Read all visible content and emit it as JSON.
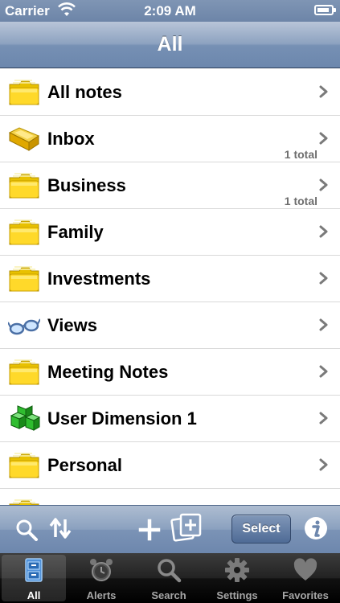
{
  "status_bar": {
    "carrier": "Carrier",
    "time": "2:09 AM"
  },
  "nav": {
    "title": "All"
  },
  "list": {
    "items": [
      {
        "label": "All notes",
        "icon": "folder-icon",
        "count": ""
      },
      {
        "label": "Inbox",
        "icon": "inbox-tray-icon",
        "count": "1 total"
      },
      {
        "label": "Business",
        "icon": "folder-icon",
        "count": "1 total"
      },
      {
        "label": "Family",
        "icon": "folder-icon",
        "count": ""
      },
      {
        "label": "Investments",
        "icon": "folder-icon",
        "count": ""
      },
      {
        "label": "Views",
        "icon": "glasses-icon",
        "count": ""
      },
      {
        "label": "Meeting Notes",
        "icon": "folder-icon",
        "count": ""
      },
      {
        "label": "User Dimension 1",
        "icon": "green-cubes-icon",
        "count": ""
      },
      {
        "label": "Personal",
        "icon": "folder-icon",
        "count": ""
      },
      {
        "label": "",
        "icon": "folder-icon",
        "count": ""
      }
    ]
  },
  "toolbar": {
    "select_label": "Select"
  },
  "tabs": [
    {
      "label": "All",
      "icon": "file-cabinet-icon",
      "active": true
    },
    {
      "label": "Alerts",
      "icon": "alarm-clock-icon",
      "active": false
    },
    {
      "label": "Search",
      "icon": "search-icon",
      "active": false
    },
    {
      "label": "Settings",
      "icon": "gear-icon",
      "active": false
    },
    {
      "label": "Favorites",
      "icon": "heart-icon",
      "active": false
    }
  ],
  "colors": {
    "nav_blue": "#7690b4",
    "tab_bar": "#111111",
    "count_gray": "#6e6e6e"
  }
}
